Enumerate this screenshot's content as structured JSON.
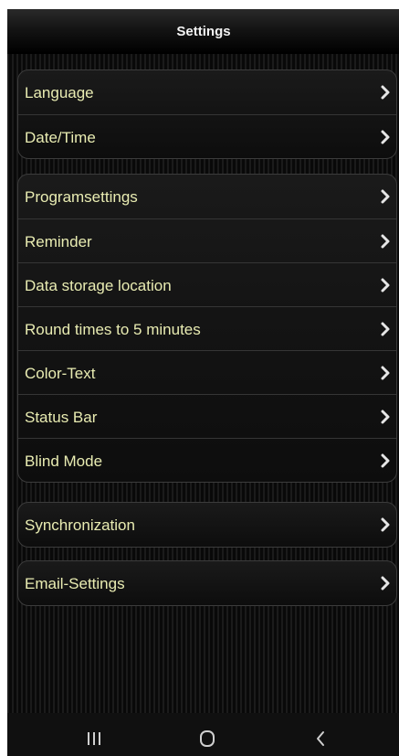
{
  "header": {
    "title": "Settings"
  },
  "groups": [
    {
      "items": [
        {
          "label": "Language"
        },
        {
          "label": "Date/Time"
        }
      ]
    },
    {
      "items": [
        {
          "label": "Programsettings"
        },
        {
          "label": "Reminder"
        },
        {
          "label": "Data storage location"
        },
        {
          "label": "Round times to 5 minutes"
        },
        {
          "label": "Color-Text"
        },
        {
          "label": "Status Bar"
        },
        {
          "label": "Blind Mode"
        }
      ]
    },
    {
      "items": [
        {
          "label": "Synchronization"
        }
      ]
    },
    {
      "items": [
        {
          "label": "Email-Settings"
        }
      ]
    }
  ],
  "row_icon": "chevron-right-icon",
  "nav": {
    "recents_icon": "recents-icon",
    "home_icon": "home-icon",
    "back_icon": "back-icon"
  },
  "colors": {
    "label_text": "#e9ecb2",
    "title_text": "#f2f2f2",
    "background": "#0a0a0a",
    "chevron": "#e6e6e6"
  }
}
